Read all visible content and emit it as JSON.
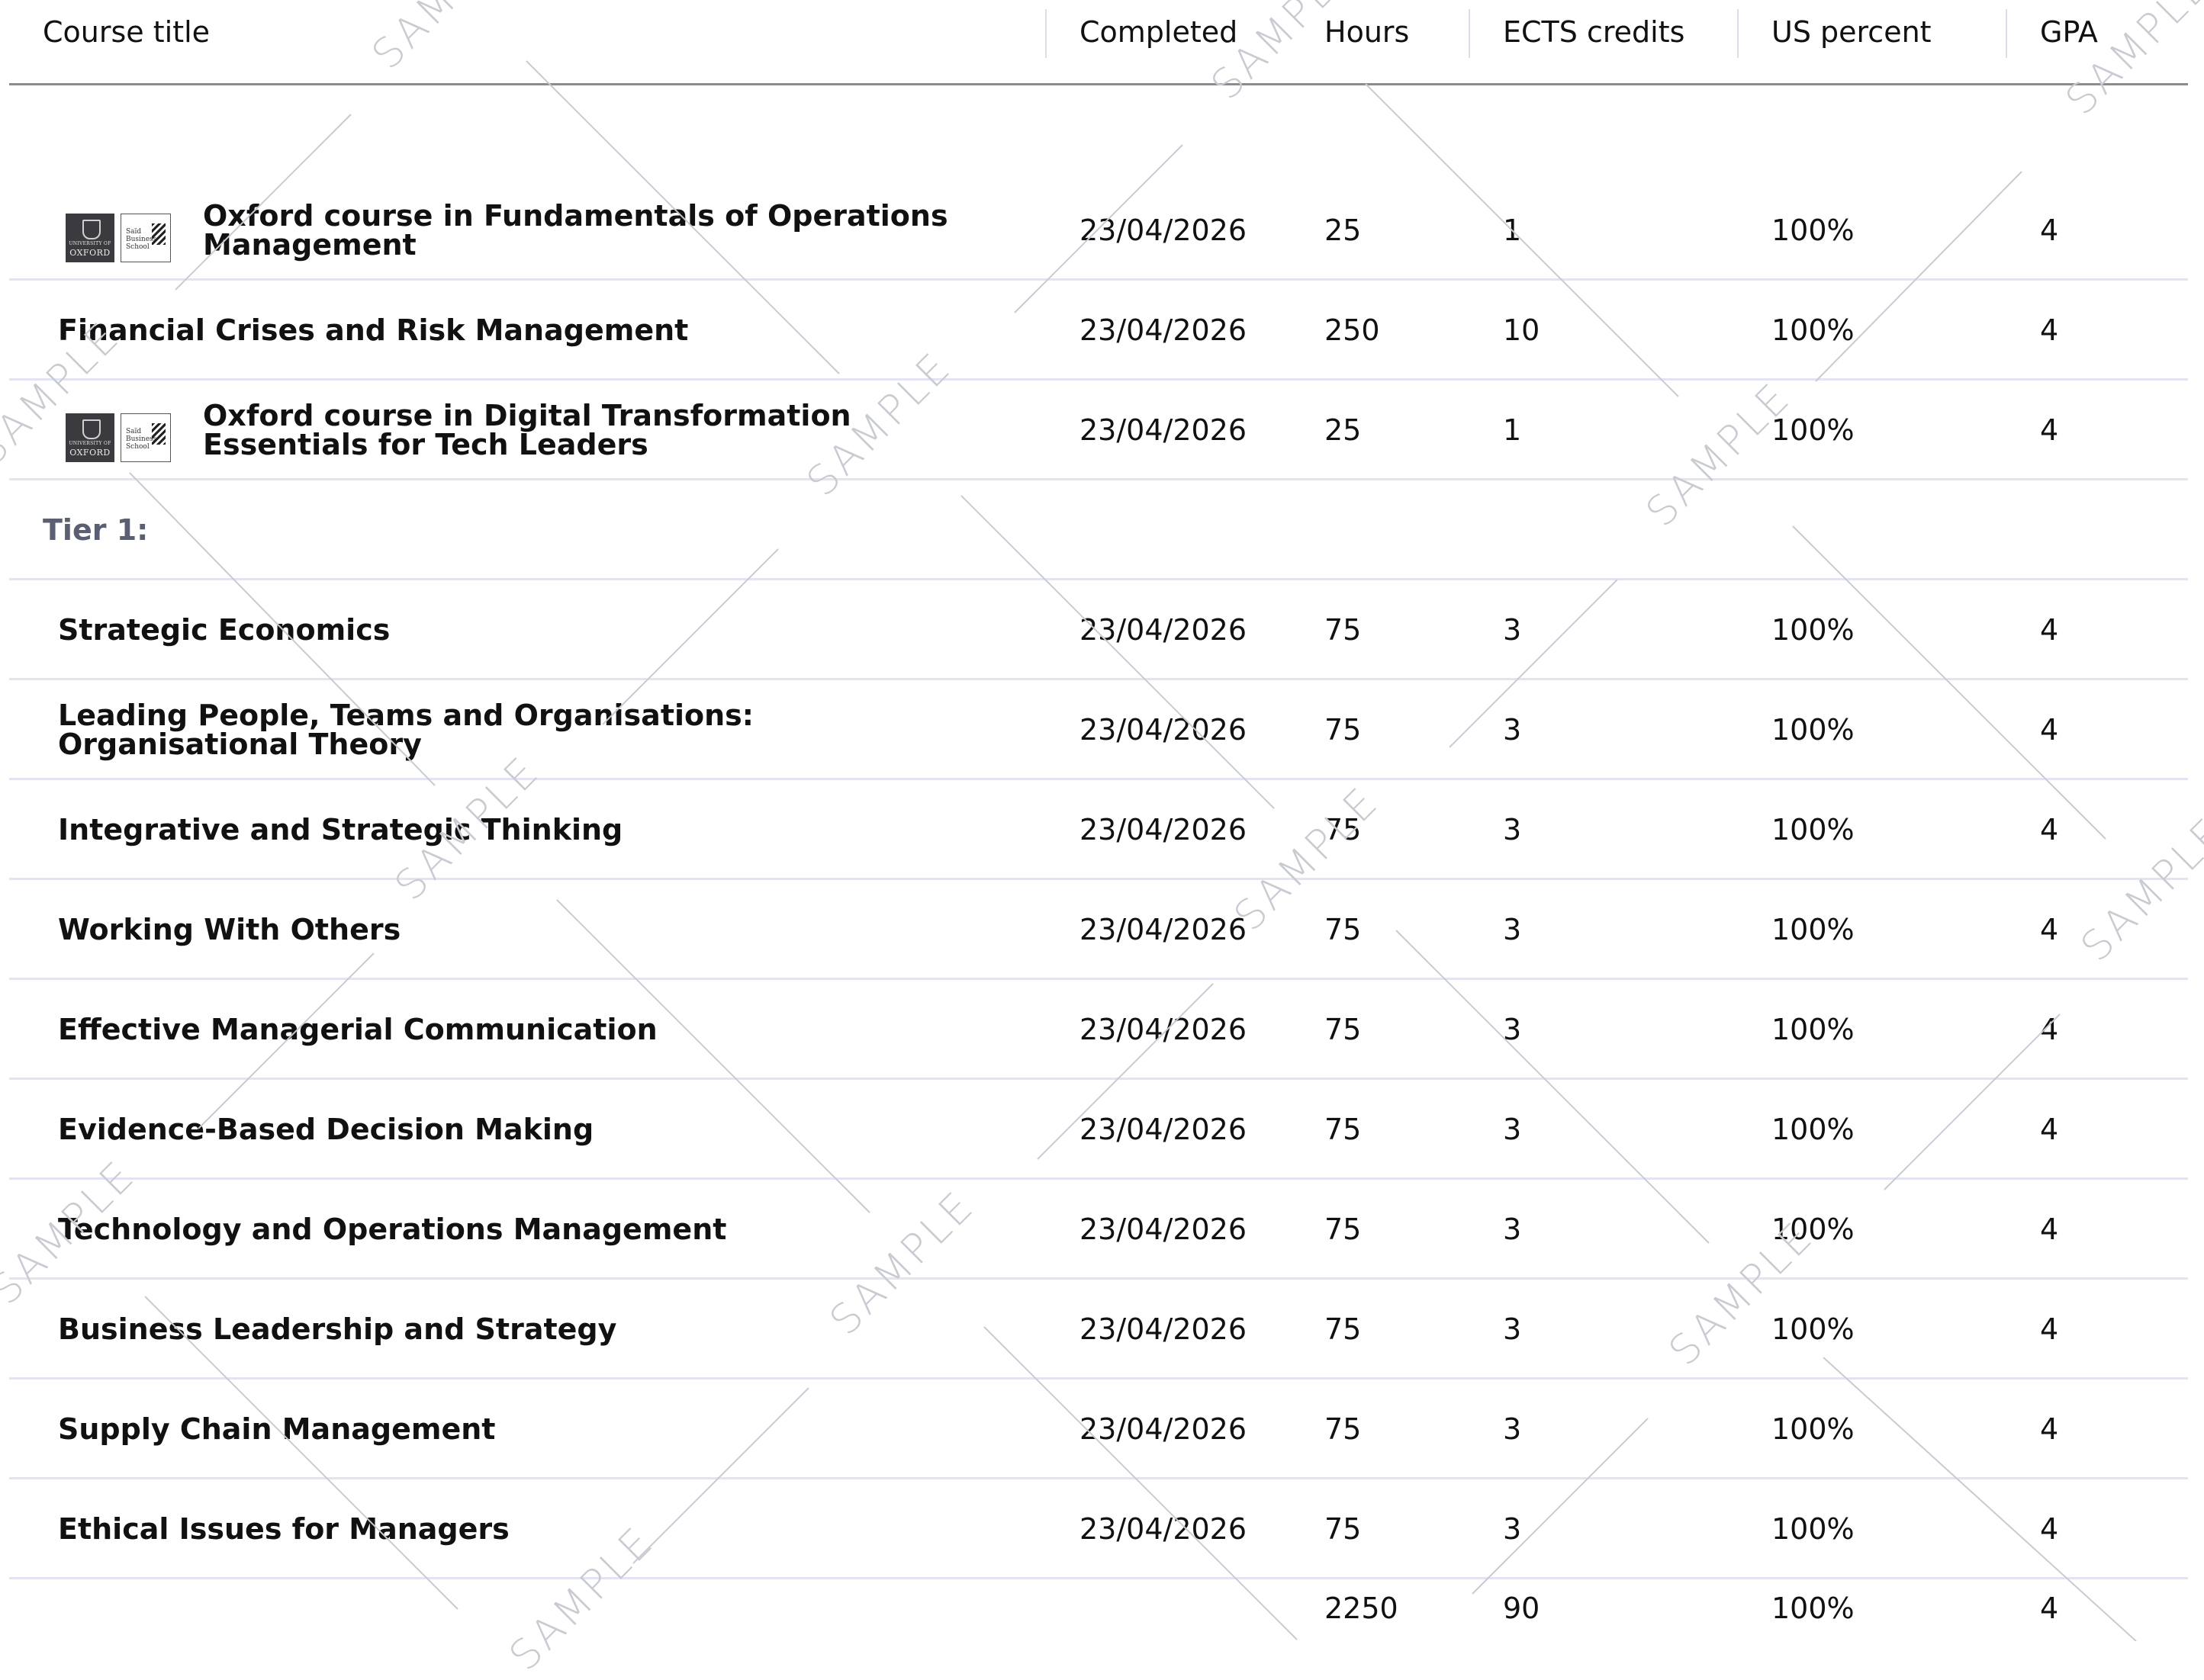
{
  "table": {
    "headers": {
      "course_title": "Course title",
      "completed": "Completed",
      "hours": "Hours",
      "ects": "ECTS credits",
      "us_percent": "US percent",
      "gpa": "GPA"
    },
    "rows": [
      {
        "kind": "course",
        "logo": "oxford-said-logo",
        "title": "Oxford course in Fundamentals of Operations Management",
        "completed": "23/04/2026",
        "hours": "25",
        "ects": "1",
        "us_percent": "100%",
        "gpa": "4"
      },
      {
        "kind": "course",
        "title": "Financial Crises and Risk Management",
        "completed": "23/04/2026",
        "hours": "250",
        "ects": "10",
        "us_percent": "100%",
        "gpa": "4"
      },
      {
        "kind": "course",
        "logo": "oxford-said-logo",
        "title": "Oxford course in Digital Transformation Essentials for Tech Leaders",
        "completed": "23/04/2026",
        "hours": "25",
        "ects": "1",
        "us_percent": "100%",
        "gpa": "4"
      },
      {
        "kind": "group",
        "label": "Tier 1:"
      },
      {
        "kind": "course",
        "title": "Strategic Economics",
        "completed": "23/04/2026",
        "hours": "75",
        "ects": "3",
        "us_percent": "100%",
        "gpa": "4"
      },
      {
        "kind": "course",
        "title": "Leading People, Teams and Organisations: Organisational Theory",
        "completed": "23/04/2026",
        "hours": "75",
        "ects": "3",
        "us_percent": "100%",
        "gpa": "4"
      },
      {
        "kind": "course",
        "title": "Integrative and Strategic Thinking",
        "completed": "23/04/2026",
        "hours": "75",
        "ects": "3",
        "us_percent": "100%",
        "gpa": "4"
      },
      {
        "kind": "course",
        "title": "Working With Others",
        "completed": "23/04/2026",
        "hours": "75",
        "ects": "3",
        "us_percent": "100%",
        "gpa": "4"
      },
      {
        "kind": "course",
        "title": "Effective Managerial Communication",
        "completed": "23/04/2026",
        "hours": "75",
        "ects": "3",
        "us_percent": "100%",
        "gpa": "4"
      },
      {
        "kind": "course",
        "title": "Evidence-Based Decision Making",
        "completed": "23/04/2026",
        "hours": "75",
        "ects": "3",
        "us_percent": "100%",
        "gpa": "4"
      },
      {
        "kind": "course",
        "title": "Technology and Operations Management",
        "completed": "23/04/2026",
        "hours": "75",
        "ects": "3",
        "us_percent": "100%",
        "gpa": "4"
      },
      {
        "kind": "course",
        "title": "Business Leadership and Strategy",
        "completed": "23/04/2026",
        "hours": "75",
        "ects": "3",
        "us_percent": "100%",
        "gpa": "4"
      },
      {
        "kind": "course",
        "title": "Supply Chain Management",
        "completed": "23/04/2026",
        "hours": "75",
        "ects": "3",
        "us_percent": "100%",
        "gpa": "4"
      },
      {
        "kind": "course",
        "title": "Ethical Issues for Managers",
        "completed": "23/04/2026",
        "hours": "75",
        "ects": "3",
        "us_percent": "100%",
        "gpa": "4"
      }
    ],
    "totals": {
      "hours": "2250",
      "ects": "90",
      "us_percent": "100%",
      "gpa": "4"
    }
  },
  "logo": {
    "crest_small": "UNIVERSITY OF",
    "crest_big": "OXFORD",
    "said_line1": "Saïd",
    "said_line2": "Business",
    "said_line3": "School"
  },
  "watermark": {
    "text": "SAMPLE",
    "color": "#c9cbd3"
  }
}
